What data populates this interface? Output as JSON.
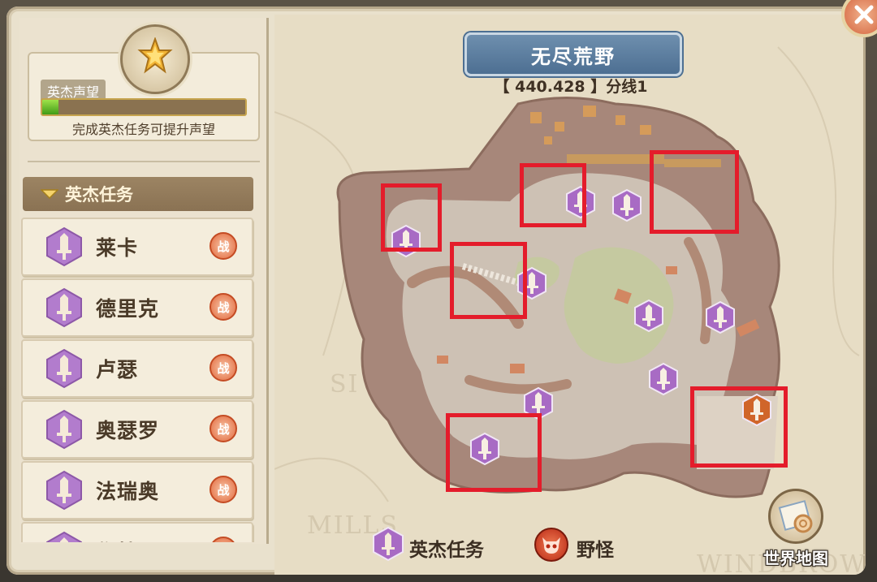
{
  "reputation": {
    "tag": "英杰声望",
    "hint": "完成英杰任务可提升声望",
    "progress_fraction": 0.08
  },
  "quest_section": {
    "header": "英杰任务",
    "fight_label": "战",
    "items": [
      {
        "name": "莱卡"
      },
      {
        "name": "德里克"
      },
      {
        "name": "卢瑟"
      },
      {
        "name": "奥瑟罗"
      },
      {
        "name": "法瑞奥"
      },
      {
        "name": "作特"
      }
    ]
  },
  "map": {
    "title": "无尽荒野",
    "coords": "【 440.428 】分线1",
    "bg_labels": [
      "SI",
      "MILLS",
      "WINDBROW"
    ]
  },
  "legend": {
    "quest_label": "英杰任务",
    "monster_label": "野怪"
  },
  "world_map_button": {
    "label": "世界地图"
  },
  "icons": {
    "quest": "sword-hexagon-icon",
    "monster": "demon-skull-icon",
    "close": "close-icon",
    "badge": "star-flame-icon",
    "world_map": "scroll-map-icon"
  },
  "colors": {
    "quest_marker": "#a86bc4",
    "special_marker": "#d0652a",
    "highlight": "#e41c2b",
    "map_title_bg": "#5a7c9e"
  }
}
